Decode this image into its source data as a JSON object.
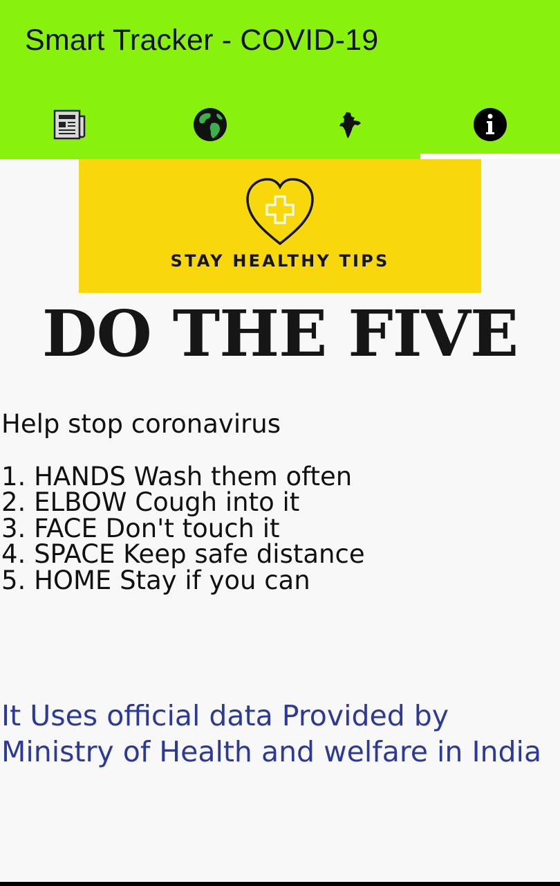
{
  "app": {
    "title": "Smart Tracker - COVID-19",
    "accent_color": "#88f20e"
  },
  "tabs": [
    {
      "icon": "newspaper-icon",
      "selected": false
    },
    {
      "icon": "globe-icon",
      "selected": false
    },
    {
      "icon": "india-map-icon",
      "selected": false
    },
    {
      "icon": "info-icon",
      "selected": true
    }
  ],
  "banner": {
    "text": "STAY HEALTHY TIPS",
    "icon": "heart-cross-icon",
    "background": "#f8d80d"
  },
  "headline": "DO THE FIVE",
  "tips": {
    "intro": "Help stop coronavirus",
    "items": [
      "1. HANDS Wash them often",
      "2. ELBOW Cough into it",
      "3. FACE Don't touch it",
      "4. SPACE Keep safe distance",
      "5. HOME Stay if you can"
    ]
  },
  "source_note": "It Uses official data Provided by Ministry of Health and welfare in India"
}
